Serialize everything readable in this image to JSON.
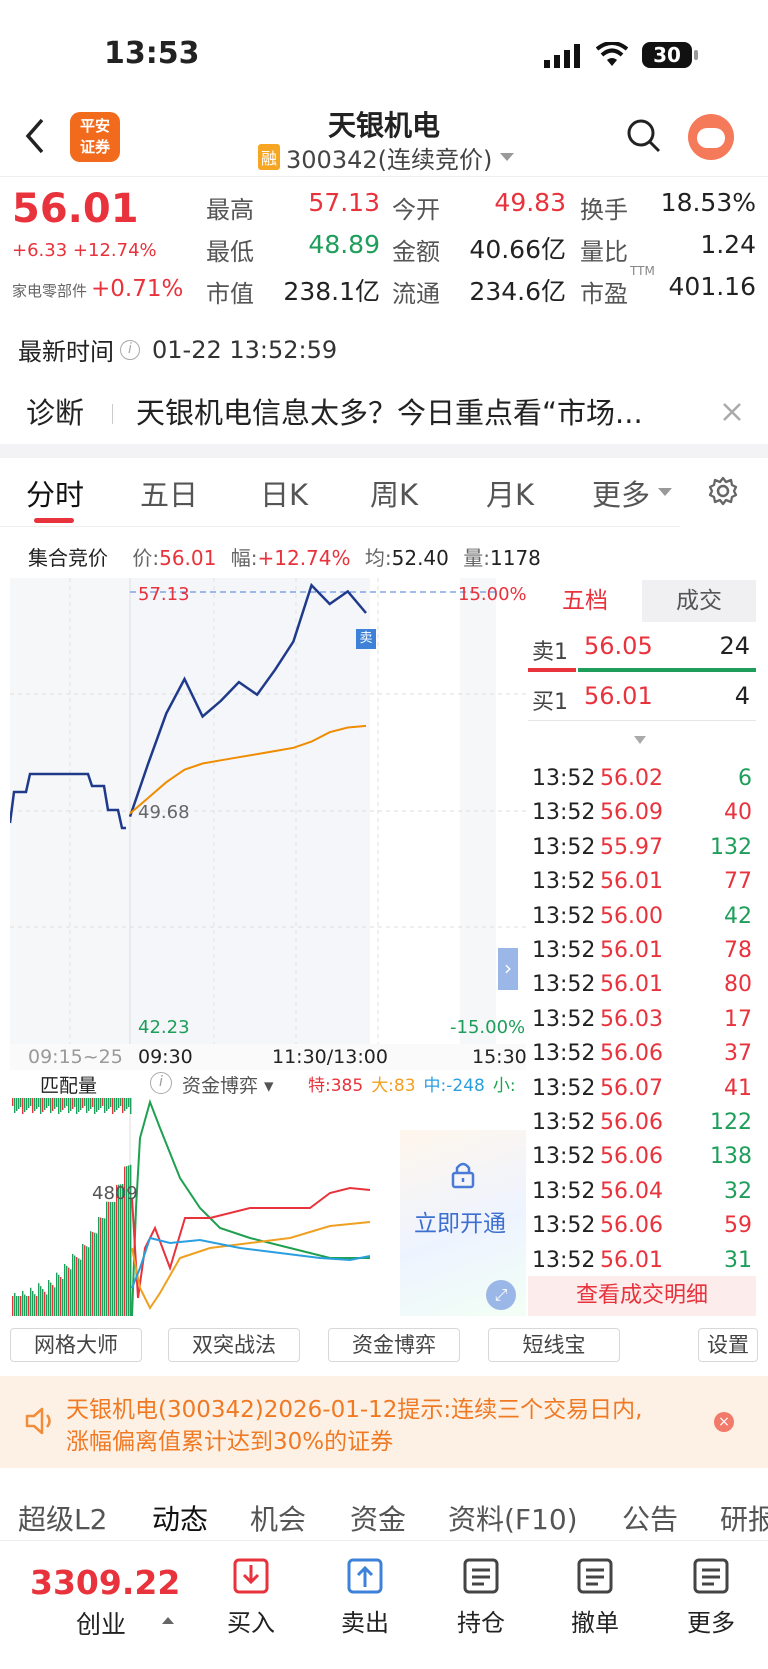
{
  "status_bar": {
    "time": "13:53",
    "battery": "30"
  },
  "header": {
    "logo_line1": "平安",
    "logo_line2": "证券",
    "title": "天银机电",
    "badge": "融",
    "code": "300342(连续竞价)"
  },
  "quote": {
    "price": "56.01",
    "change": "+6.33",
    "change_pct": "+12.74%",
    "sector_name": "家电零部件",
    "sector_pct": "+0.71%",
    "stats": [
      {
        "label": "最高",
        "value": "57.13",
        "color": "red"
      },
      {
        "label": "今开",
        "value": "49.83",
        "color": "red"
      },
      {
        "label": "换手",
        "value": "18.53%",
        "color": "blk"
      },
      {
        "label": "最低",
        "value": "48.89",
        "color": "green"
      },
      {
        "label": "金额",
        "value": "40.66亿",
        "color": "blk"
      },
      {
        "label": "量比",
        "value": "1.24",
        "color": "blk"
      },
      {
        "label": "市值",
        "value": "238.1亿",
        "color": "blk"
      },
      {
        "label": "流通",
        "value": "234.6亿",
        "color": "blk"
      },
      {
        "label": "市盈",
        "value": "401.16",
        "color": "blk"
      }
    ],
    "pe_suffix": "TTM"
  },
  "update": {
    "label": "最新时间",
    "time": "01-22 13:52:59"
  },
  "diagnosis": {
    "label": "诊断",
    "text": "天银机电信息太多？今日重点看“市场..."
  },
  "tabs": [
    {
      "label": "分时",
      "active": true
    },
    {
      "label": "五日"
    },
    {
      "label": "日K"
    },
    {
      "label": "周K"
    },
    {
      "label": "月K"
    },
    {
      "label": "更多"
    }
  ],
  "auction": {
    "title": "集合竞价",
    "price_label": "价:",
    "price": "56.01",
    "pct_label": "幅:",
    "pct": "+12.74%",
    "avg_label": "均:",
    "avg": "52.40",
    "vol_label": "量:",
    "vol": "1178"
  },
  "chart": {
    "top_price": "57.13",
    "top_pct": "15.00%",
    "bottom_price": "42.23",
    "bottom_pct": "-15.00%",
    "mid_price": "49.68",
    "sell_marker": "卖",
    "time_labels": [
      "09:15~25",
      "09:30",
      "11:30/13:00",
      "15:30"
    ],
    "sub_title": "匹配量",
    "sub_indicator": "资金博弈",
    "legend": [
      {
        "label": "特:385",
        "color": "#e8323c"
      },
      {
        "label": "大:83",
        "color": "#f0a020"
      },
      {
        "label": "中:-248",
        "color": "#2a9fe0"
      },
      {
        "label": "小:",
        "color": "#1ea050"
      }
    ],
    "sub_value": "4809",
    "unlock": "立即开通"
  },
  "chart_data": {
    "type": "line",
    "title": "",
    "ylim": [
      42.23,
      57.13
    ],
    "reference_price": 49.68,
    "series": [
      {
        "name": "",
        "color": "#1f3a8a",
        "x": [
          "09:30",
          "09:45",
          "10:00",
          "10:15",
          "10:30",
          "10:45",
          "11:00",
          "11:15",
          "11:30",
          "13:00",
          "13:15",
          "13:30",
          "13:45",
          "13:52"
        ],
        "values": [
          49.5,
          51.2,
          52.8,
          53.9,
          52.7,
          53.2,
          53.8,
          53.4,
          54.2,
          55.1,
          56.9,
          56.3,
          56.7,
          56.01
        ]
      },
      {
        "name": "",
        "color": "#f08c00",
        "x": [
          "09:30",
          "09:45",
          "10:00",
          "10:15",
          "10:30",
          "10:45",
          "11:00",
          "11:15",
          "11:30",
          "13:00",
          "13:15",
          "13:30",
          "13:45",
          "13:52"
        ],
        "values": [
          49.6,
          50.1,
          50.6,
          51.0,
          51.2,
          51.3,
          51.4,
          51.5,
          51.6,
          51.7,
          51.9,
          52.2,
          52.35,
          52.4
        ]
      }
    ]
  },
  "order_book": {
    "tabs": [
      "五档",
      "成交"
    ],
    "ask": {
      "label": "卖1",
      "price": "56.05",
      "vol": "24"
    },
    "bid": {
      "label": "买1",
      "price": "56.01",
      "vol": "4"
    },
    "trades": [
      {
        "t": "13:52",
        "p": "56.02",
        "v": "6",
        "c": "green"
      },
      {
        "t": "13:52",
        "p": "56.09",
        "v": "40",
        "c": "red"
      },
      {
        "t": "13:52",
        "p": "55.97",
        "v": "132",
        "c": "green"
      },
      {
        "t": "13:52",
        "p": "56.01",
        "v": "77",
        "c": "red"
      },
      {
        "t": "13:52",
        "p": "56.00",
        "v": "42",
        "c": "green"
      },
      {
        "t": "13:52",
        "p": "56.01",
        "v": "78",
        "c": "red"
      },
      {
        "t": "13:52",
        "p": "56.01",
        "v": "80",
        "c": "red"
      },
      {
        "t": "13:52",
        "p": "56.03",
        "v": "17",
        "c": "red"
      },
      {
        "t": "13:52",
        "p": "56.06",
        "v": "37",
        "c": "red"
      },
      {
        "t": "13:52",
        "p": "56.07",
        "v": "41",
        "c": "red"
      },
      {
        "t": "13:52",
        "p": "56.06",
        "v": "122",
        "c": "green"
      },
      {
        "t": "13:52",
        "p": "56.06",
        "v": "138",
        "c": "green"
      },
      {
        "t": "13:52",
        "p": "56.04",
        "v": "32",
        "c": "green"
      },
      {
        "t": "13:52",
        "p": "56.06",
        "v": "59",
        "c": "red"
      },
      {
        "t": "13:52",
        "p": "56.01",
        "v": "31",
        "c": "green"
      }
    ],
    "detail_link": "查看成交明细"
  },
  "tools": [
    "网格大师",
    "双突战法",
    "资金博弈",
    "短线宝",
    "设置"
  ],
  "notice": {
    "line1": "天银机电(300342)2026-01-12提示:连续三个交易日内,",
    "line2": "涨幅偏离值累计达到30%的证券"
  },
  "bottom_tabs": [
    "超级L2",
    "动态",
    "机会",
    "资金",
    "资料(F10)",
    "公告",
    "研报"
  ],
  "footer": {
    "index_value": "3309.22",
    "index_name": "创业",
    "actions": [
      "买入",
      "卖出",
      "持仓",
      "撤单",
      "更多"
    ]
  }
}
